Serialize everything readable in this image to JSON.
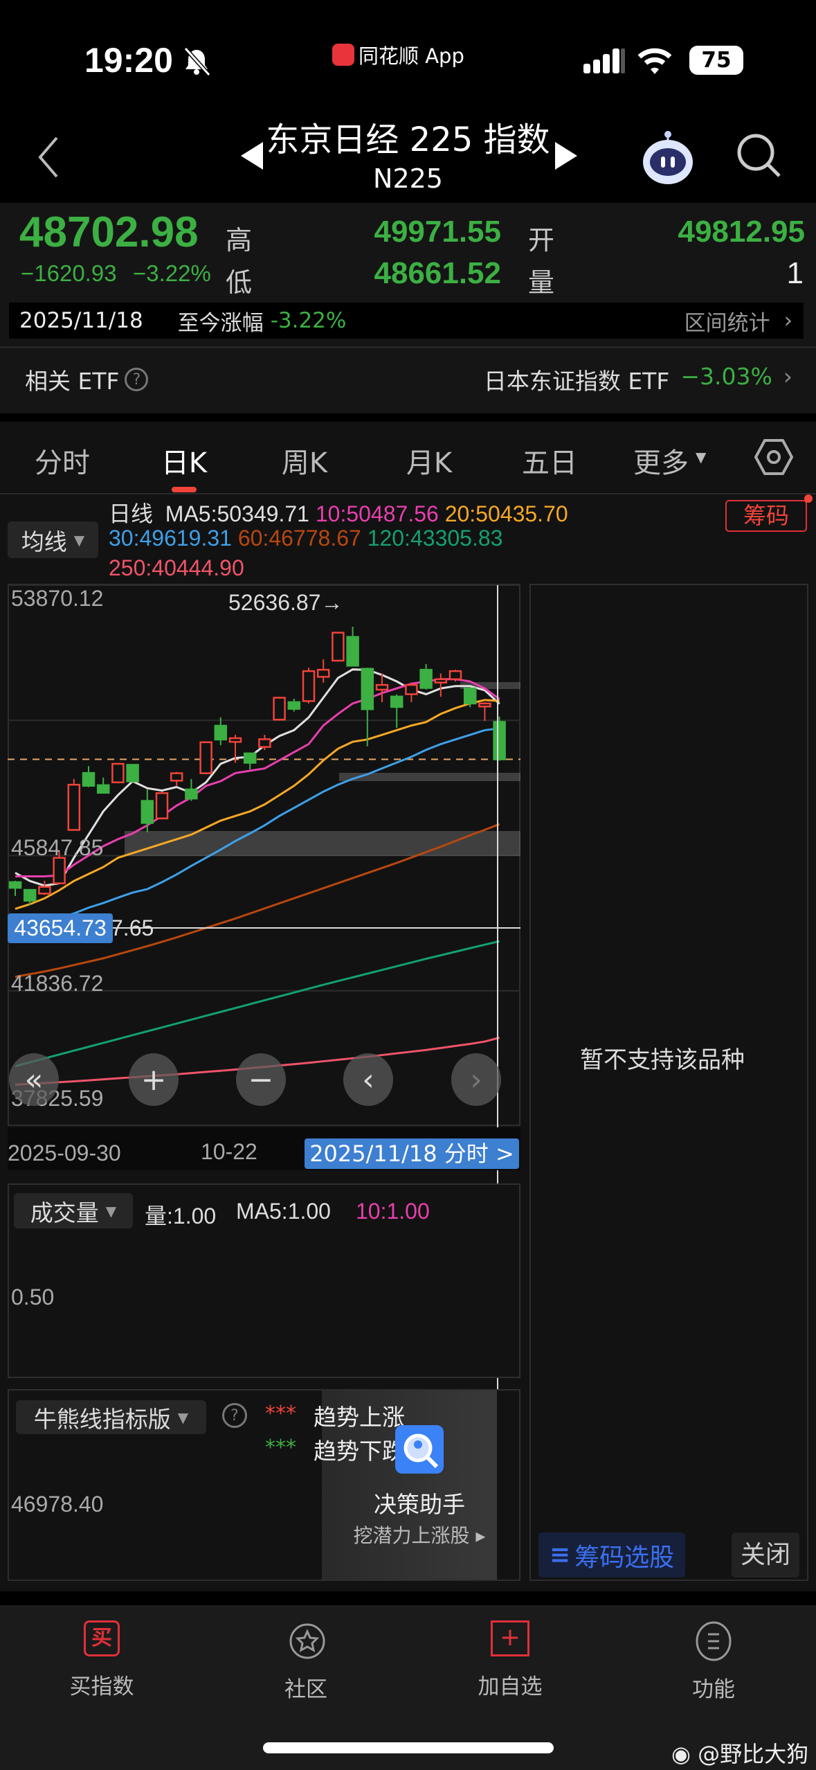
{
  "status_bar": {
    "time": "19:20",
    "app": "同花顺 App",
    "battery": "75"
  },
  "header": {
    "title": "东京日经 225 指数",
    "code": "N225"
  },
  "quote": {
    "price": "48702.98",
    "change": "−1620.93",
    "change_pct": "−3.22%",
    "high_label": "高",
    "high": "49971.55",
    "low_label": "低",
    "low": "48661.52",
    "open_label": "开",
    "open": "49812.95",
    "volume_label": "量",
    "volume": "1",
    "date": "2025/11/18",
    "since_label": "至今涨幅",
    "since_pct": "-3.22%",
    "range_stats": "区间统计",
    "etf_label": "相关 ETF",
    "etf_name": "日本东证指数 ETF",
    "etf_pct": "−3.03%"
  },
  "tabs": [
    {
      "label": "分时"
    },
    {
      "label": "日K"
    },
    {
      "label": "周K"
    },
    {
      "label": "月K"
    },
    {
      "label": "五日"
    },
    {
      "label": "更多"
    }
  ],
  "active_tab": "日K",
  "ma_legend": {
    "selector": "均线",
    "period": "日线",
    "chip_button": "筹码",
    "items": [
      {
        "text": "MA5:50349.71",
        "color": "#e0e0e0"
      },
      {
        "text": "10:50487.56",
        "color": "#e83fae"
      },
      {
        "text": "20:50435.70",
        "color": "#f7a825"
      },
      {
        "text": "30:49619.31",
        "color": "#3ea0e8"
      },
      {
        "text": "60:46778.67",
        "color": "#b9470f"
      },
      {
        "text": "120:43305.83",
        "color": "#14a070"
      },
      {
        "text": "250:40444.90",
        "color": "#f0546a"
      }
    ]
  },
  "chart_data": {
    "type": "candlestick",
    "y_ticks": [
      "53870.12",
      "45847.85",
      "41836.72",
      "37825.59"
    ],
    "ylim": [
      37825.59,
      53870.12
    ],
    "max_label": "52636.87→",
    "crosshair_price": "43654.73",
    "partial_tick": "7.65",
    "x_labels": [
      "2025-09-30",
      "10-22"
    ],
    "selected_date": "2025/11/18 分时 >",
    "current_price": 48702.98,
    "candles": [
      [
        45060,
        44890,
        45100,
        44650
      ],
      [
        44830,
        44510,
        44850,
        44370
      ],
      [
        44720,
        44920,
        45100,
        44680
      ],
      [
        45025,
        45780,
        46000,
        45000
      ],
      [
        46608,
        47950,
        48120,
        46600
      ],
      [
        48300,
        47917,
        48500,
        47880
      ],
      [
        47937,
        47710,
        48160,
        47700
      ],
      [
        48020,
        48570,
        48600,
        47990
      ],
      [
        48540,
        48050,
        48540,
        48050
      ],
      [
        47470,
        46815,
        47810,
        46540
      ],
      [
        46950,
        47700,
        47750,
        46920
      ],
      [
        48070,
        48290,
        48330,
        47920
      ],
      [
        47810,
        47540,
        48120,
        47470
      ],
      [
        48290,
        49210,
        49220,
        48260
      ],
      [
        49700,
        49290,
        49950,
        49120
      ],
      [
        49220,
        49330,
        49430,
        48600
      ],
      [
        48880,
        48600,
        48880,
        48400
      ],
      [
        49070,
        49300,
        49430,
        48980
      ],
      [
        49880,
        50530,
        50560,
        49850
      ],
      [
        50400,
        50200,
        50500,
        50120
      ],
      [
        50430,
        51320,
        51420,
        50360
      ],
      [
        51150,
        51360,
        51670,
        50980
      ],
      [
        51630,
        52460,
        52490,
        51600
      ],
      [
        52335,
        51480,
        52637,
        51480
      ],
      [
        51390,
        50190,
        51420,
        49090
      ],
      [
        50770,
        50910,
        51250,
        50400
      ],
      [
        50566,
        50256,
        50630,
        49636
      ],
      [
        50635,
        50910,
        50980,
        50400
      ],
      [
        51360,
        50820,
        51530,
        50770
      ],
      [
        50980,
        51080,
        51250,
        50560
      ],
      [
        51080,
        51320,
        51360,
        51010
      ],
      [
        50807,
        50360,
        50807,
        50250
      ],
      [
        50270,
        50360,
        50390,
        49840
      ],
      [
        49813,
        48703,
        49972,
        48662
      ]
    ],
    "ma": {
      "MA5": [
        45335,
        45094,
        44956,
        45025,
        45782,
        46470,
        47159,
        47641,
        48054,
        47847,
        47778,
        47881,
        47710,
        48020,
        48570,
        48742,
        48776,
        49120,
        49395,
        49568,
        49947,
        50531,
        51117,
        51370,
        51357,
        51206,
        51014,
        50773,
        50635,
        50807,
        50876,
        50876,
        50752,
        50350
      ],
      "MA10": [
        45232,
        45232,
        45232,
        45260,
        45576,
        45851,
        46126,
        46333,
        46505,
        46746,
        47022,
        47331,
        47572,
        47916,
        48054,
        48295,
        48364,
        48433,
        48673,
        48914,
        49155,
        49706,
        50050,
        50360,
        50497,
        50669,
        50807,
        50945,
        51014,
        51082,
        51082,
        51014,
        50807,
        50488
      ],
      "MA20": [
        44268,
        44405,
        44578,
        44818,
        45094,
        45300,
        45507,
        45782,
        45920,
        46057,
        46195,
        46333,
        46470,
        46677,
        46884,
        47022,
        47159,
        47365,
        47641,
        47916,
        48260,
        48673,
        49018,
        49224,
        49293,
        49430,
        49568,
        49705,
        49809,
        50050,
        50222,
        50360,
        50463,
        50436
      ],
      "MA30": [
        43500,
        43700,
        43850,
        44000,
        44130,
        44302,
        44440,
        44598,
        44750,
        44853,
        45060,
        45287,
        45541,
        45782,
        46023,
        46278,
        46505,
        46746,
        47022,
        47262,
        47503,
        47744,
        47951,
        48123,
        48260,
        48433,
        48605,
        48777,
        48983,
        49155,
        49293,
        49430,
        49568,
        49619
      ],
      "MA60": [
        42250,
        42330,
        42410,
        42500,
        42600,
        42700,
        42800,
        42920,
        43040,
        43160,
        43290,
        43420,
        43560,
        43700,
        43840,
        43980,
        44130,
        44280,
        44430,
        44580,
        44730,
        44880,
        45030,
        45180,
        45330,
        45480,
        45630,
        45790,
        45950,
        46110,
        46280,
        46450,
        46610,
        46779
      ],
      "MA120": [
        39600,
        39715,
        39830,
        39945,
        40060,
        40175,
        40290,
        40405,
        40520,
        40635,
        40750,
        40865,
        40980,
        41095,
        41210,
        41325,
        41440,
        41555,
        41670,
        41785,
        41900,
        42015,
        42125,
        42235,
        42345,
        42455,
        42565,
        42675,
        42785,
        42890,
        42995,
        43100,
        43205,
        43306
      ],
      "MA250": [
        39050,
        39075,
        39100,
        39125,
        39150,
        39180,
        39210,
        39240,
        39270,
        39300,
        39330,
        39360,
        39395,
        39430,
        39465,
        39500,
        39540,
        39580,
        39620,
        39660,
        39700,
        39745,
        39790,
        39835,
        39880,
        39930,
        39980,
        40030,
        40080,
        40140,
        40200,
        40260,
        40330,
        40445
      ]
    }
  },
  "volume": {
    "selector": "成交量",
    "vol": "量:1.00",
    "ma5": "MA5:1.00",
    "ma10": "10:1.00",
    "mid_tick": "0.50",
    "values_all": 1.0
  },
  "indicator": {
    "selector": "牛熊线指标版",
    "up_stars": "***",
    "up_label": "趋势上涨",
    "down_stars": "***",
    "down_label": "趋势下跌",
    "tick": "46978.40",
    "popup_title": "决策助手",
    "popup_link": "挖潜力上涨股"
  },
  "right_panel": {
    "message": "暂不支持该品种",
    "chip_pick": "筹码选股",
    "close": "关闭"
  },
  "bottom_nav": [
    {
      "label": "买指数"
    },
    {
      "label": "社区"
    },
    {
      "label": "加自选"
    },
    {
      "label": "功能"
    }
  ],
  "buy_glyph": "买",
  "watermark": "@野比大狗",
  "colors": {
    "up": "#f0443a",
    "down": "#3cb043",
    "accent_blue": "#3d7fd0"
  }
}
